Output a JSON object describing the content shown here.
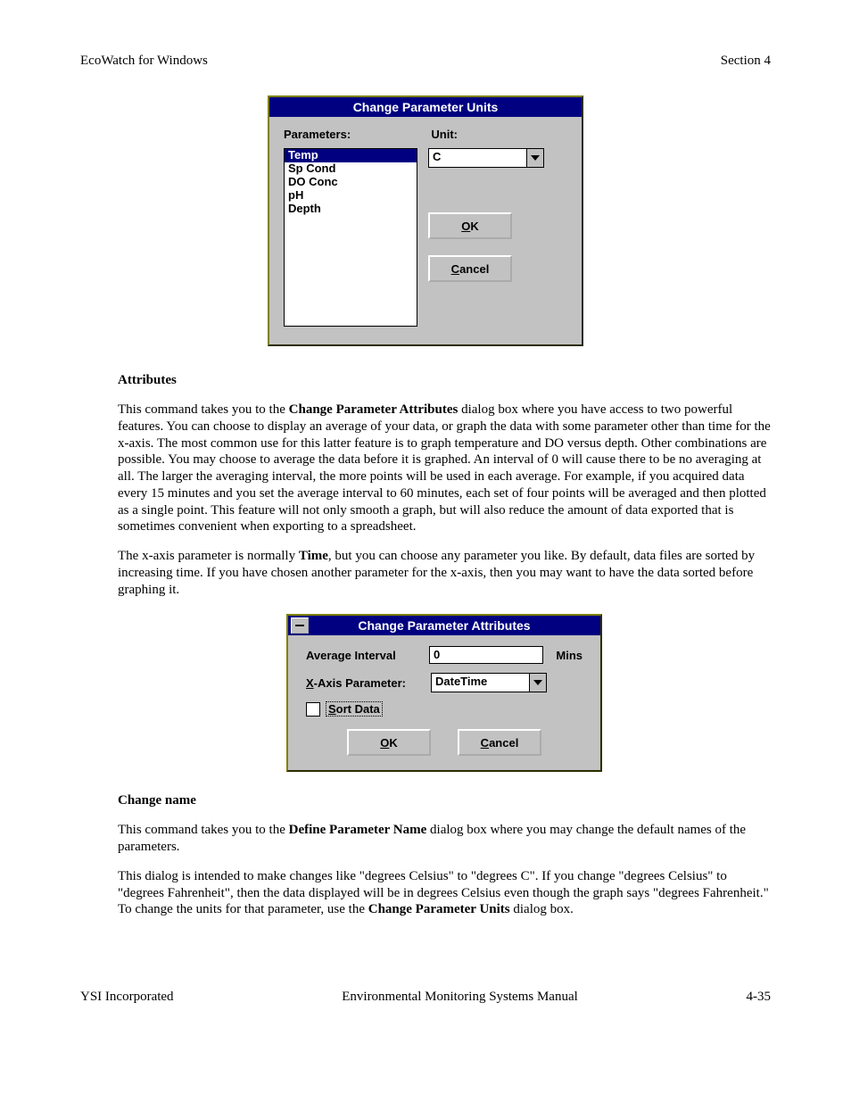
{
  "header": {
    "left": "EcoWatch for Windows",
    "right": "Section 4"
  },
  "dialog1": {
    "title": "Change Parameter Units",
    "parameters_label": "Parameters:",
    "unit_label": "Unit:",
    "items": [
      "Temp",
      "Sp Cond",
      "DO Conc",
      "pH",
      "Depth"
    ],
    "selected_index": 0,
    "unit_value": "C",
    "ok_label": "OK",
    "cancel_label": "Cancel"
  },
  "section_attributes": {
    "heading": "Attributes",
    "p1_a": "This command takes you to the ",
    "p1_bold": "Change Parameter Attributes",
    "p1_b": " dialog box where you have access to two powerful features.  You can choose to display an average of your data, or graph the data with some parameter other than time for the x-axis.  The most common use for this latter feature is to graph temperature and DO versus depth. Other combinations are possible. You may choose to average the data before it is graphed.  An interval of 0 will cause there to be no averaging at all.  The larger the averaging interval, the more points will be used in each average.  For example, if you acquired data every 15 minutes and you set the average interval to 60 minutes, each set of four points will be averaged and then plotted as a single point.  This feature will not only smooth a graph, but will also reduce the amount of data exported that is sometimes convenient when exporting to a spreadsheet.",
    "p2_a": "The x-axis parameter is normally ",
    "p2_bold": "Time",
    "p2_b": ", but you can choose any parameter you like.  By default, data files are sorted by increasing time.  If you have chosen another parameter for the x-axis, then you may want to have the data sorted before graphing it."
  },
  "dialog2": {
    "title": "Change Parameter Attributes",
    "avg_label": "Average Interval",
    "avg_value": "0",
    "mins_label": "Mins",
    "x_label_pre": "X",
    "x_label_post": "-Axis Parameter:",
    "x_value": "DateTime",
    "sort_label": "Sort Data",
    "ok_label": "OK",
    "cancel_label": "Cancel"
  },
  "section_changename": {
    "heading": "Change name",
    "p1_a": "This command takes you to the ",
    "p1_bold": "Define Parameter Name",
    "p1_b": " dialog box where you may change the default names of the parameters.",
    "p2_a": "This dialog is intended to make changes like \"degrees Celsius\" to \"degrees C\".  If you change \"degrees Celsius\" to \"degrees Fahrenheit\", then the data displayed will be in degrees Celsius even though the graph says \"degrees Fahrenheit.\"  To change the units for that parameter, use the ",
    "p2_bold": "Change Parameter Units",
    "p2_b": " dialog box."
  },
  "footer": {
    "left": "YSI Incorporated",
    "center": "Environmental Monitoring Systems Manual",
    "right": "4-35"
  }
}
